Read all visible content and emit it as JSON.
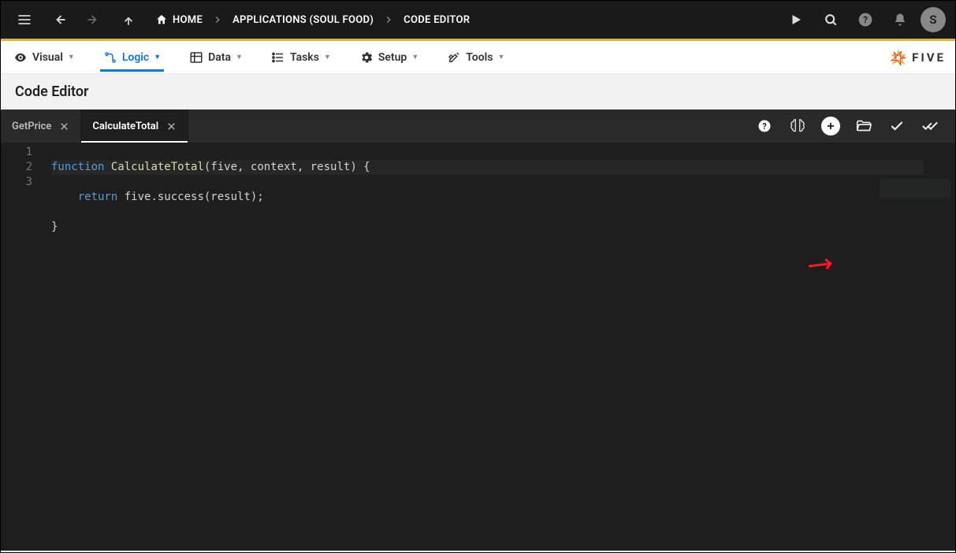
{
  "topbar": {
    "breadcrumb": {
      "home": "HOME",
      "applications": "APPLICATIONS (SOUL FOOD)",
      "current": "CODE EDITOR"
    },
    "avatar_initial": "S"
  },
  "menubar": {
    "visual": "Visual",
    "logic": "Logic",
    "data": "Data",
    "tasks": "Tasks",
    "setup": "Setup",
    "tools": "Tools",
    "brand": "FIVE"
  },
  "page_title": "Code Editor",
  "tabs": [
    {
      "label": "GetPrice",
      "active": false
    },
    {
      "label": "CalculateTotal",
      "active": true
    }
  ],
  "code": {
    "line_numbers": [
      "1",
      "2",
      "3"
    ],
    "line1": {
      "kw": "function",
      "fn": "CalculateTotal",
      "rest": "(five, context, result) {"
    },
    "line2": {
      "kw": "return",
      "rest": " five.success(result);"
    },
    "line3": "}"
  }
}
